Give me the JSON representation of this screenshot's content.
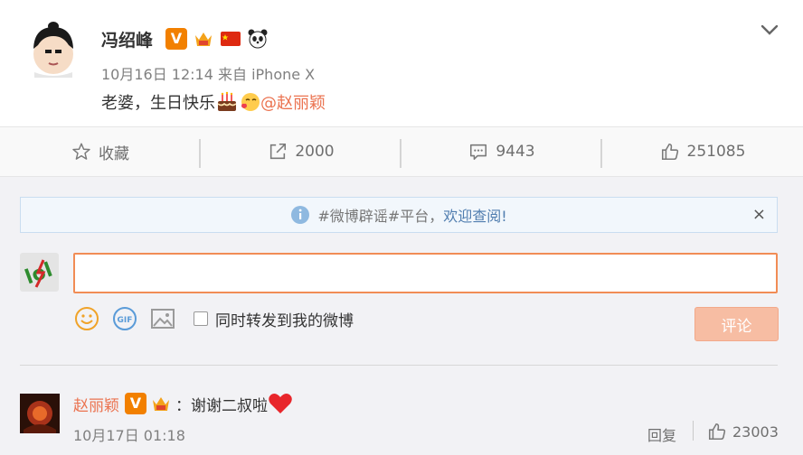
{
  "post": {
    "author": "冯绍峰",
    "verified_badge": "V",
    "meta": "10月16日 12:14 来自 iPhone X",
    "text": "老婆，生日快乐",
    "mention": "@赵丽颖",
    "badge_icons": [
      "vip-crown-icon",
      "china-flag-icon",
      "panda-icon"
    ],
    "emoji_icons": [
      "birthday-cake-emoji",
      "kiss-emoji"
    ]
  },
  "actions": {
    "favorite": "收藏",
    "repost": "2000",
    "comment": "9443",
    "like": "251085"
  },
  "notice": {
    "tag": "#微博辟谣#平台，",
    "link": "欢迎查阅!",
    "close": "×"
  },
  "composer": {
    "input_value": "",
    "repost_label": "同时转发到我的微博",
    "submit_label": "评论",
    "tool_icons": [
      "emoji-icon",
      "gif-icon",
      "image-icon"
    ]
  },
  "reply": {
    "author": "赵丽颖",
    "colon": "：",
    "text": "谢谢二叔啦",
    "time": "10月17日 01:18",
    "reply_label": "回复",
    "likes": "23003"
  },
  "colors": {
    "accent": "#eb7350",
    "input_border": "#f18c55",
    "submit_bg": "#f7bda3",
    "link_blue": "#507daf"
  }
}
